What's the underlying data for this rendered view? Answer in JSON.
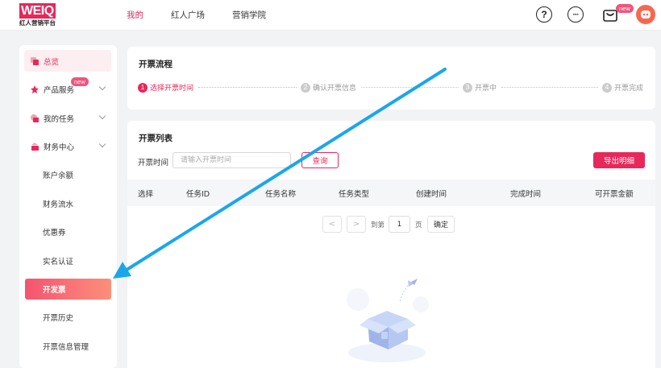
{
  "header": {
    "logo_mark": "WEIQ",
    "logo_sub": "红人营销平台",
    "nav": [
      {
        "label": "我的",
        "active": true
      },
      {
        "label": "红人广场",
        "active": false
      },
      {
        "label": "营销学院",
        "active": false
      }
    ],
    "help_glyph": "?",
    "more_glyph": "···",
    "new_badge": "new"
  },
  "sidebar": {
    "items": [
      {
        "label": "总览",
        "icon": "overview-icon"
      },
      {
        "label": "产品服务",
        "icon": "product-service-icon",
        "badge": "new"
      },
      {
        "label": "我的任务",
        "icon": "my-tasks-icon"
      },
      {
        "label": "财务中心",
        "icon": "finance-icon"
      }
    ],
    "finance_subitems": [
      {
        "label": "账户余额"
      },
      {
        "label": "财务流水"
      },
      {
        "label": "优惠券"
      },
      {
        "label": "实名认证"
      },
      {
        "label": "开发票",
        "active": true
      },
      {
        "label": "开票历史"
      },
      {
        "label": "开票信息管理"
      }
    ]
  },
  "flow": {
    "title": "开票流程",
    "steps": [
      {
        "num": "1",
        "label": "选择开票时间",
        "active": true
      },
      {
        "num": "2",
        "label": "确认开票信息",
        "active": false
      },
      {
        "num": "3",
        "label": "开票中",
        "active": false
      },
      {
        "num": "4",
        "label": "开票完成",
        "active": false
      }
    ]
  },
  "list": {
    "title": "开票列表",
    "filter_label": "开票时间",
    "date_placeholder": "请输入开票时间",
    "query_label": "查询",
    "export_label": "导出明细",
    "columns": [
      "选择",
      "任务ID",
      "任务名称",
      "任务类型",
      "创建时间",
      "完成时间",
      "可开票金额"
    ],
    "pager": {
      "prev": "<",
      "next": ">",
      "goto_prefix": "到第",
      "page_value": "1",
      "goto_suffix": "页",
      "confirm_label": "确定"
    }
  },
  "colors": {
    "brand": "#e8275a",
    "annotation_arrow": "#1aa7ea"
  }
}
